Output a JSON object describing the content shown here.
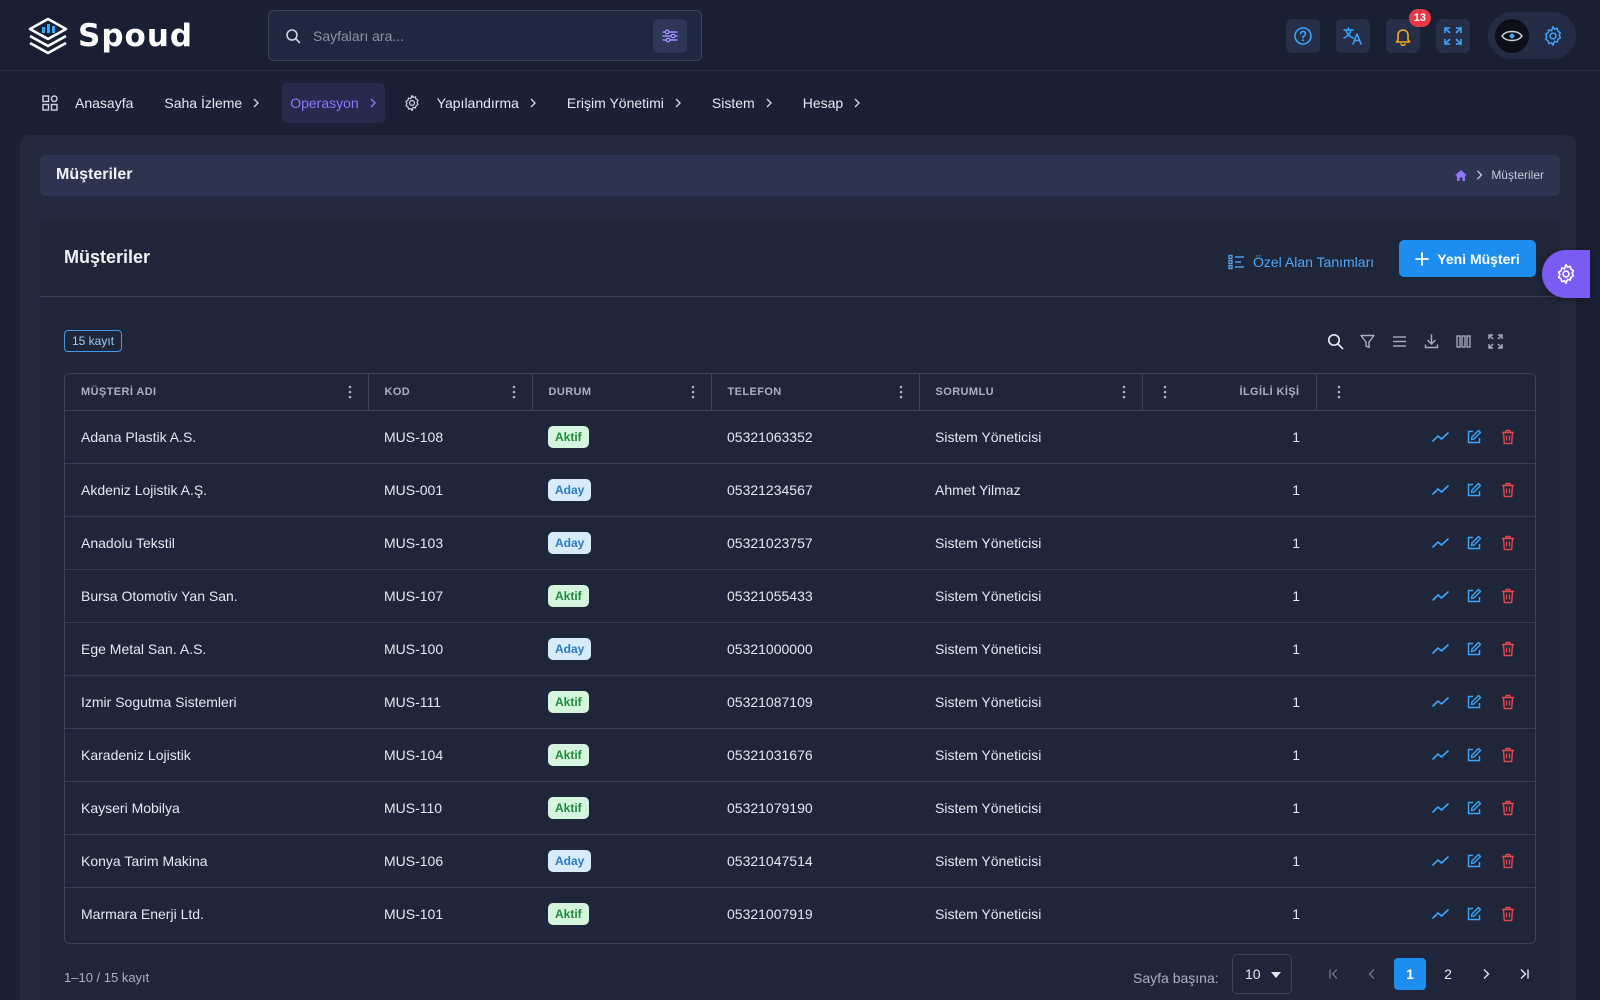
{
  "brand": {
    "name": "Spoud"
  },
  "search": {
    "placeholder": "Sayfaları ara..."
  },
  "notifications": {
    "count": "13"
  },
  "nav": {
    "items": [
      {
        "label": "Anasayfa",
        "icon": "dashboard-icon",
        "chevron": false,
        "active": false
      },
      {
        "label": "Saha İzleme",
        "icon": "",
        "chevron": true,
        "active": false
      },
      {
        "label": "Operasyon",
        "icon": "",
        "chevron": true,
        "active": true
      },
      {
        "label": "Yapılandırma",
        "icon": "gear-icon",
        "chevron": true,
        "active": false
      },
      {
        "label": "Erişim Yönetimi",
        "icon": "",
        "chevron": true,
        "active": false
      },
      {
        "label": "Sistem",
        "icon": "",
        "chevron": true,
        "active": false
      },
      {
        "label": "Hesap",
        "icon": "",
        "chevron": true,
        "active": false
      }
    ]
  },
  "page": {
    "title": "Müşteriler",
    "breadcrumb": "Müşteriler"
  },
  "card": {
    "title": "Müşteriler",
    "custom_fields_label": "Özel Alan Tanımları",
    "new_button_label": "Yeni Müşteri",
    "record_count": "15 kayıt"
  },
  "table": {
    "columns": [
      "MÜŞTERİ ADI",
      "KOD",
      "DURUM",
      "TELEFON",
      "SORUMLU",
      "İLGİLİ KİŞİ"
    ],
    "rows": [
      {
        "name": "Adana Plastik A.S.",
        "code": "MUS-108",
        "status": "Aktif",
        "phone": "05321063352",
        "owner": "Sistem Yöneticisi",
        "contacts": "1"
      },
      {
        "name": "Akdeniz Lojistik A.Ş.",
        "code": "MUS-001",
        "status": "Aday",
        "phone": "05321234567",
        "owner": "Ahmet Yilmaz",
        "contacts": "1"
      },
      {
        "name": "Anadolu Tekstil",
        "code": "MUS-103",
        "status": "Aday",
        "phone": "05321023757",
        "owner": "Sistem Yöneticisi",
        "contacts": "1"
      },
      {
        "name": "Bursa Otomotiv Yan San.",
        "code": "MUS-107",
        "status": "Aktif",
        "phone": "05321055433",
        "owner": "Sistem Yöneticisi",
        "contacts": "1"
      },
      {
        "name": "Ege Metal San. A.S.",
        "code": "MUS-100",
        "status": "Aday",
        "phone": "05321000000",
        "owner": "Sistem Yöneticisi",
        "contacts": "1"
      },
      {
        "name": "Izmir Sogutma Sistemleri",
        "code": "MUS-111",
        "status": "Aktif",
        "phone": "05321087109",
        "owner": "Sistem Yöneticisi",
        "contacts": "1"
      },
      {
        "name": "Karadeniz Lojistik",
        "code": "MUS-104",
        "status": "Aktif",
        "phone": "05321031676",
        "owner": "Sistem Yöneticisi",
        "contacts": "1"
      },
      {
        "name": "Kayseri Mobilya",
        "code": "MUS-110",
        "status": "Aktif",
        "phone": "05321079190",
        "owner": "Sistem Yöneticisi",
        "contacts": "1"
      },
      {
        "name": "Konya Tarim Makina",
        "code": "MUS-106",
        "status": "Aday",
        "phone": "05321047514",
        "owner": "Sistem Yöneticisi",
        "contacts": "1"
      },
      {
        "name": "Marmara Enerji Ltd.",
        "code": "MUS-101",
        "status": "Aktif",
        "phone": "05321007919",
        "owner": "Sistem Yöneticisi",
        "contacts": "1"
      }
    ]
  },
  "footer": {
    "range_text": "1–10 / 15 kayıt",
    "per_page_label": "Sayfa başına:",
    "per_page_value": "10",
    "pages": [
      "1",
      "2"
    ],
    "current_page": "1"
  },
  "colors": {
    "accent": "#1e8df0",
    "active_nav": "#8f77ff",
    "status_aktif": "#1f8a3d",
    "status_aday": "#2a7ac7",
    "delete": "#e5484d"
  }
}
